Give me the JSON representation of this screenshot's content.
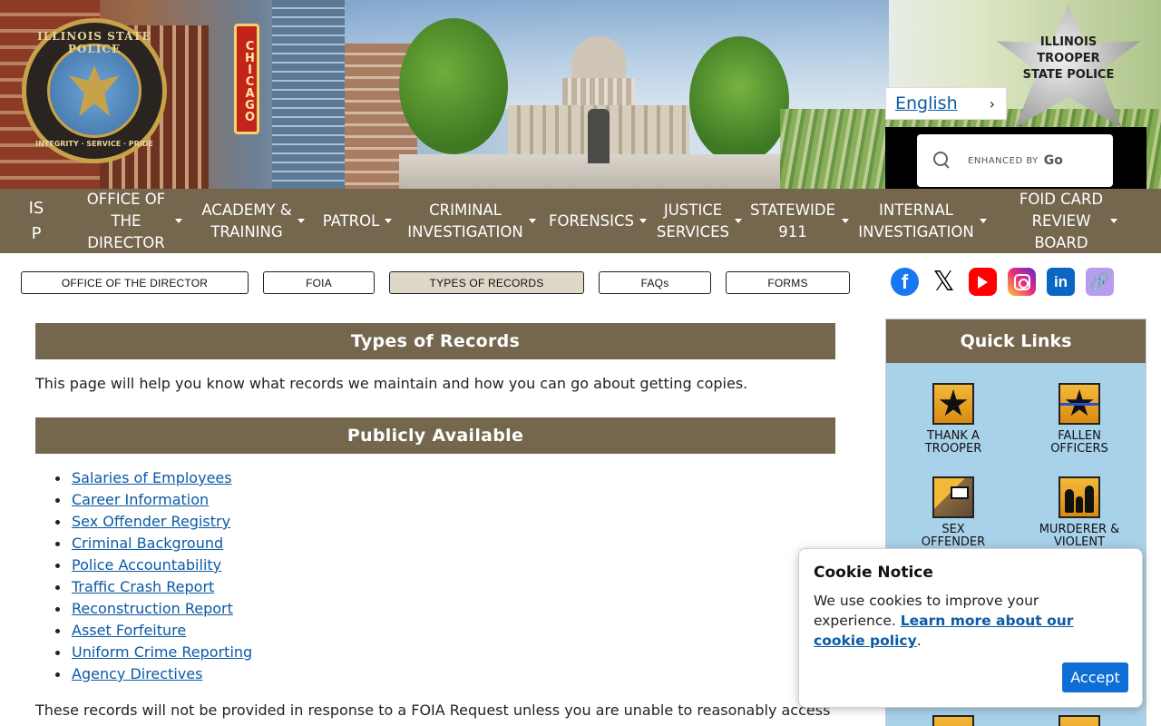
{
  "banner": {
    "seal_text": "ILLINOIS STATE POLICE",
    "seal_motto": "INTEGRITY · SERVICE · PRIDE",
    "chicago_sign": "CHICAGO",
    "badge_lines": [
      "ILLINOIS",
      "TROOPER",
      "STATE POLICE"
    ]
  },
  "language": {
    "label": "English",
    "chevron": "›"
  },
  "search": {
    "placeholder": "ENHANCED BY",
    "google_mark": "Go"
  },
  "nav": {
    "items": [
      {
        "label": "IS P",
        "has_menu": false
      },
      {
        "label": "OFFICE OF THE DIRECTOR",
        "has_menu": true
      },
      {
        "label": "ACADEMY & TRAINING",
        "has_menu": true
      },
      {
        "label": "PATROL",
        "has_menu": true
      },
      {
        "label": "CRIMINAL INVESTIGATION",
        "has_menu": true
      },
      {
        "label": "FORENSICS",
        "has_menu": true
      },
      {
        "label": "JUSTICE SERVICES",
        "has_menu": true
      },
      {
        "label": "STATEWIDE 911",
        "has_menu": true
      },
      {
        "label": "INTERNAL INVESTIGATION",
        "has_menu": true
      },
      {
        "label": "FOID CARD REVIEW BOARD",
        "has_menu": true
      }
    ]
  },
  "subnav": {
    "buttons": [
      "OFFICE OF THE DIRECTOR",
      "FOIA",
      "TYPES OF RECORDS",
      "FAQs",
      "FORMS"
    ],
    "active": "TYPES OF RECORDS"
  },
  "social": {
    "facebook": "f",
    "x": "𝕏",
    "linkedin": "in",
    "link": "🔗"
  },
  "main": {
    "title": "Types of Records",
    "intro": "This page will help you know what records we maintain and how you can go about getting copies.",
    "section_title": "Publicly Available",
    "records": [
      "Salaries of Employees",
      "Career Information",
      "Sex Offender Registry",
      "Criminal Background",
      "Police Accountability",
      "Traffic Crash Report",
      "Reconstruction Report",
      "Asset Forfeiture",
      "Uniform Crime Reporting",
      "Agency Directives"
    ],
    "footer_text": "These records will not be provided in response to a FOIA Request unless you are unable to reasonably access"
  },
  "quick_links": {
    "title": "Quick Links",
    "tiles": [
      {
        "label": "THANK A TROOPER"
      },
      {
        "label": "FALLEN OFFICERS"
      },
      {
        "label": "SEX OFFENDER"
      },
      {
        "label": "MURDERER & VIOLENT"
      }
    ]
  },
  "cookie": {
    "title": "Cookie Notice",
    "text": "We use cookies to improve your experience.",
    "link_text": "Learn more about our cookie policy",
    "trailing": ".",
    "accept_label": "Accept"
  },
  "colors": {
    "brand_brown": "#75674e",
    "link_blue": "#0b5aa6",
    "quick_links_bg": "#a8d1ea",
    "accept_blue": "#0d6fd6"
  }
}
